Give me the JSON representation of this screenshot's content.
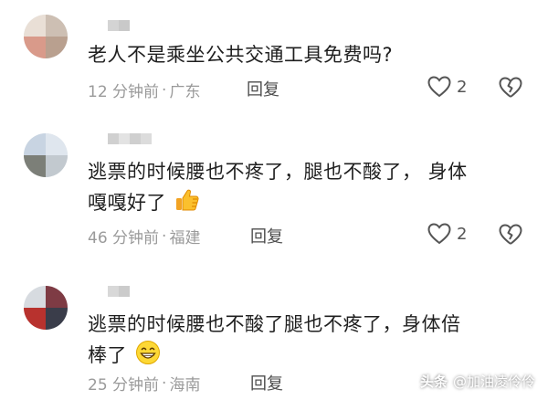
{
  "comments": [
    {
      "text_lines": [
        "老人不是乘坐公共交通工具免费吗?"
      ],
      "time": "12 分钟前",
      "location": "广东",
      "reply_label": "回复",
      "likes": "2"
    },
    {
      "text_lines": [
        "逃票的时候腰也不疼了，腿也不酸了， 身体",
        "嘎嘎好了"
      ],
      "time": "46 分钟前",
      "location": "福建",
      "reply_label": "回复",
      "likes": "2",
      "emoji": "thumbs-up-icon"
    },
    {
      "text_lines": [
        "逃票的时候腰也不酸了腿也不疼了，身体倍",
        "棒了"
      ],
      "time": "25 分钟前",
      "location": "海南",
      "reply_label": "回复",
      "emoji": "grinning-face-icon"
    }
  ],
  "separator": "·",
  "watermark": {
    "brand": "头条",
    "account": "@加油凌伶伶"
  }
}
